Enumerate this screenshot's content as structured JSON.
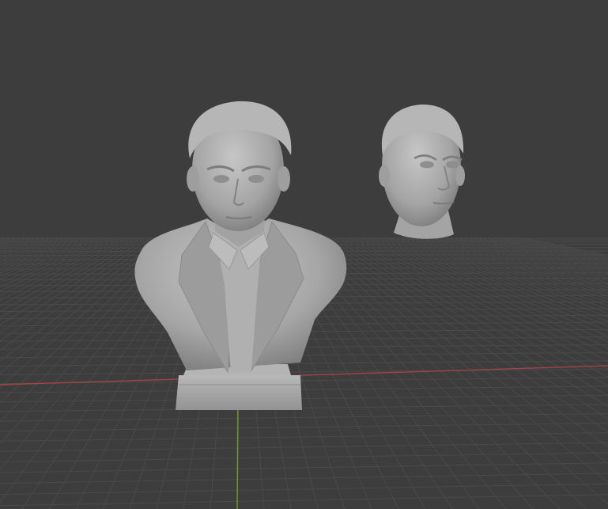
{
  "viewport": {
    "background_color": "#3d3d3d",
    "grid_color": "#4a4a4a",
    "x_axis_color": "#a3424a",
    "y_axis_color": "#6f9a2a",
    "model_color": "#a8a8a8",
    "grid_visible": true
  },
  "objects": [
    {
      "name": "bust-with-pedestal",
      "kind": "sculpted bust on base"
    },
    {
      "name": "head-only",
      "kind": "sculpted head"
    }
  ]
}
